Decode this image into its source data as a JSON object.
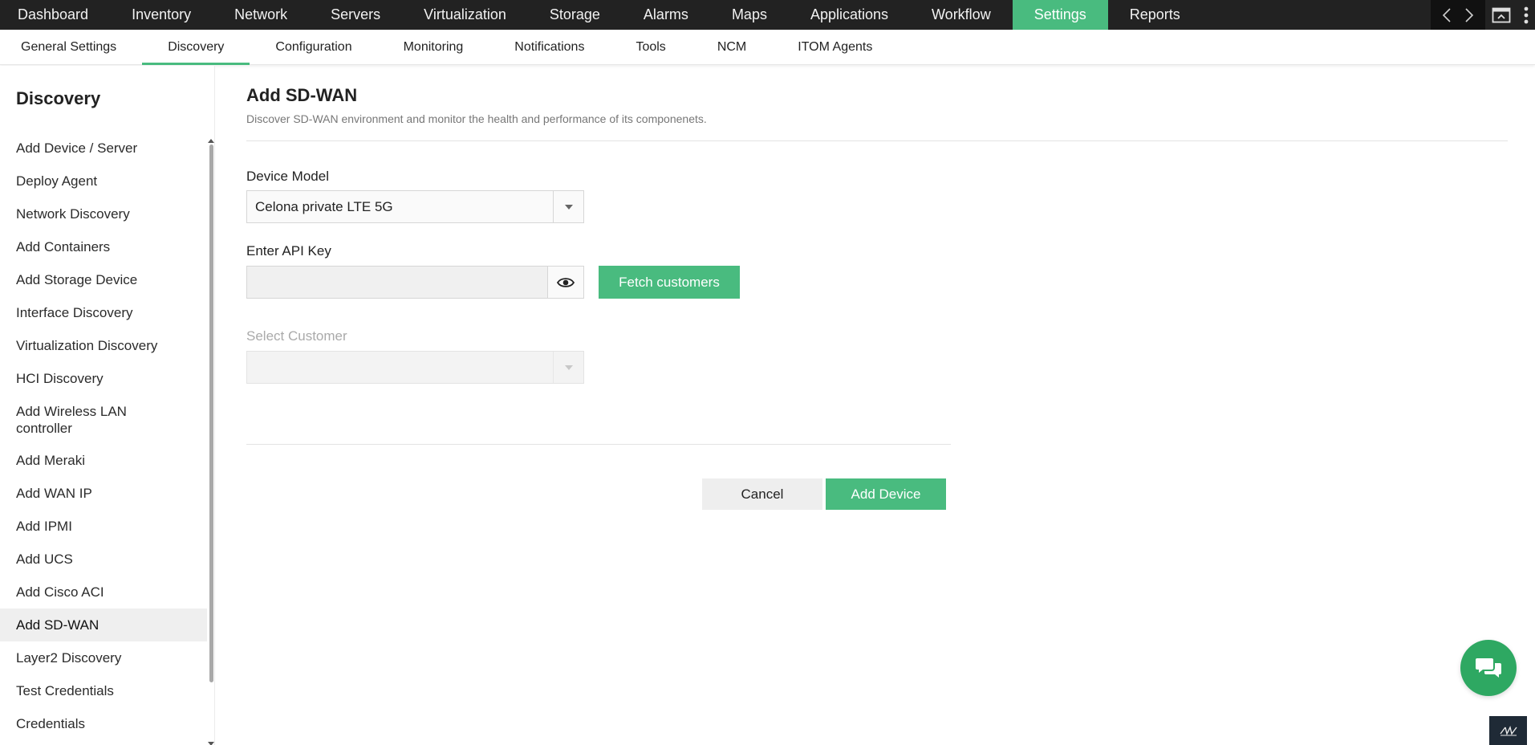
{
  "topnav": {
    "items": [
      "Dashboard",
      "Inventory",
      "Network",
      "Servers",
      "Virtualization",
      "Storage",
      "Alarms",
      "Maps",
      "Applications",
      "Workflow",
      "Settings",
      "Reports"
    ],
    "active": "Settings"
  },
  "subnav": {
    "items": [
      "General Settings",
      "Discovery",
      "Configuration",
      "Monitoring",
      "Notifications",
      "Tools",
      "NCM",
      "ITOM Agents"
    ],
    "active": "Discovery"
  },
  "sidebar": {
    "title": "Discovery",
    "items": [
      "Add Device / Server",
      "Deploy Agent",
      "Network Discovery",
      "Add Containers",
      "Add Storage Device",
      "Interface Discovery",
      "Virtualization Discovery",
      "HCI Discovery",
      "Add Wireless LAN controller",
      "Add Meraki",
      "Add WAN IP",
      "Add IPMI",
      "Add UCS",
      "Add Cisco ACI",
      "Add SD-WAN",
      "Layer2 Discovery",
      "Test Credentials",
      "Credentials"
    ],
    "active": "Add SD-WAN"
  },
  "main": {
    "title": "Add SD-WAN",
    "description": "Discover SD-WAN environment and monitor the health and performance of its componenets.",
    "device_model_label": "Device Model",
    "device_model_value": "Celona private LTE 5G",
    "api_key_label": "Enter API Key",
    "api_key_value": "",
    "fetch_button": "Fetch customers",
    "select_customer_label": "Select Customer",
    "select_customer_value": "",
    "cancel_button": "Cancel",
    "add_button": "Add Device"
  },
  "colors": {
    "accent": "#49bb7f",
    "topbar": "#222222"
  },
  "icons": {
    "nav_prev": "chevron-left-icon",
    "nav_next": "chevron-right-icon",
    "screen": "screen-icon",
    "more": "more-vertical-icon",
    "eye": "eye-icon",
    "caret": "caret-down-icon",
    "chat": "chat-icon"
  }
}
